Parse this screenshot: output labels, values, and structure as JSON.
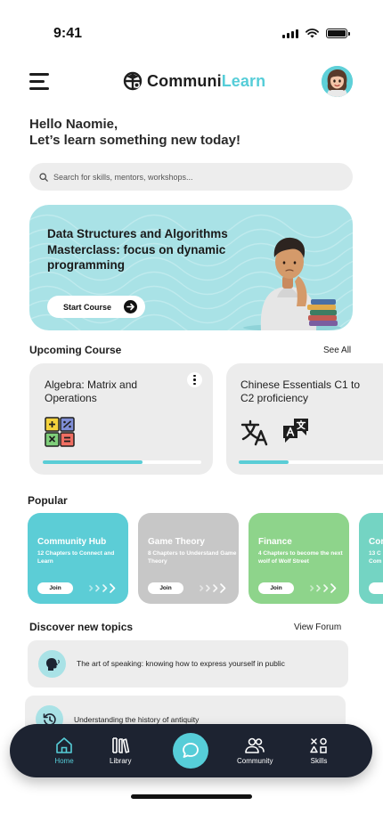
{
  "status": {
    "time": "9:41"
  },
  "app": {
    "logo_part1": "Communi",
    "logo_part2": "Learn",
    "brand_color": "#56cdd8"
  },
  "greeting": {
    "line1": "Hello Naomie,",
    "line2": "Let’s learn something new today!"
  },
  "search": {
    "placeholder": "Search for skills, mentors, workshops..."
  },
  "hero": {
    "title": "Data Structures and Algorithms Masterclass: focus on dynamic programming",
    "button_label": "Start Course"
  },
  "upcoming": {
    "heading": "Upcoming Course",
    "see_all": "See All",
    "courses": [
      {
        "title": "Algebra: Matrix and Operations",
        "progress": 0.63
      },
      {
        "title": "Chinese Essentials C1 to C2 proficiency",
        "progress": 0.32
      }
    ]
  },
  "popular": {
    "heading": "Popular",
    "items": [
      {
        "title": "Community Hub",
        "subtitle": "12 Chapters to Connect and Learn",
        "join": "Join",
        "color": "#5ccdd6"
      },
      {
        "title": "Game Theory",
        "subtitle": "8 Chapters to Understand Game Theory",
        "join": "Join",
        "color": "#c7c7c7"
      },
      {
        "title": "Finance",
        "subtitle": "4 Chapters to become the next wolf of Wolf Street",
        "join": "Join",
        "color": "#8ed48b"
      },
      {
        "title": "Cor",
        "subtitle": "13 C Com",
        "join": "J",
        "color": "#74d4c3"
      }
    ]
  },
  "discover": {
    "heading": "Discover new topics",
    "view_forum": "View Forum",
    "topics": [
      {
        "text": "The art of speaking: knowing how to express yourself in public"
      },
      {
        "text": "Understanding the history of antiquity"
      }
    ]
  },
  "tabs": {
    "home": "Home",
    "library": "Library",
    "community": "Community",
    "skills": "Skills"
  }
}
